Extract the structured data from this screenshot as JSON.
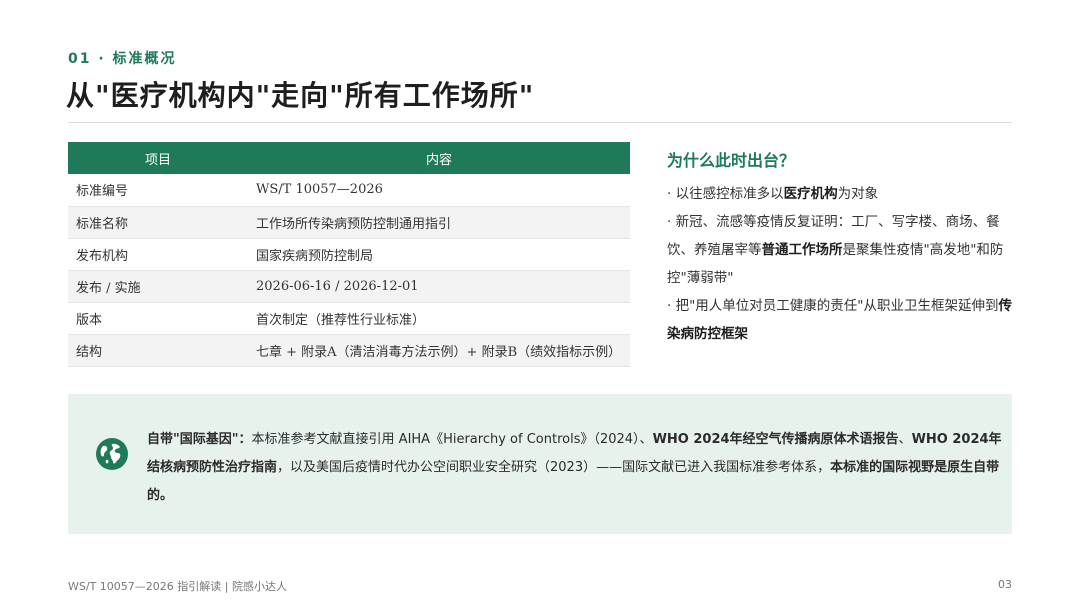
{
  "section_label": "01 · 标准概况",
  "title": "从\"医疗机构内\"走向\"所有工作场所\"",
  "table": {
    "headers": [
      "项目",
      "内容"
    ],
    "rows": [
      [
        "标准编号",
        "WS/T 10057—2026"
      ],
      [
        "标准名称",
        "工作场所传染病预防控制通用指引"
      ],
      [
        "发布机构",
        "国家疾病预防控制局"
      ],
      [
        "发布 / 实施",
        "2026-06-16 / 2026-12-01"
      ],
      [
        "版本",
        "首次制定（推荐性行业标准）"
      ],
      [
        "结构",
        "七章 + 附录A（清洁消毒方法示例）+ 附录B（绩效指标示例）"
      ]
    ]
  },
  "why": {
    "title": "为什么此时出台？",
    "p1_a": "· 以往感控标准多以",
    "p1_b": "医疗机构",
    "p1_c": "为对象",
    "p2_a": "· 新冠、流感等疫情反复证明：工厂、写字楼、商场、餐饮、养殖屠宰等",
    "p2_b": "普通工作场所",
    "p2_c": "是聚集性疫情\"高发地\"和防控\"薄弱带\"",
    "p3_a": "· 把\"用人单位对员工健康的责任\"从职业卫生框架延伸到",
    "p3_b": "传染病防控框架"
  },
  "callout": {
    "lead": "自带\"国际基因\"：",
    "t1": "本标准参考文献直接引用 AIHA《Hierarchy of Controls》（2024）、",
    "b1": "WHO 2024年经空气传播病原体术语报告",
    "t2": "、",
    "b2": "WHO 2024年结核病预防性治疗指南",
    "t3": "，以及美国后疫情时代办公空间职业安全研究（2023）——国际文献已进入我国标准参考体系，",
    "b3": "本标准的国际视野是原生自带的。"
  },
  "footer": {
    "left": "WS/T 10057—2026 指引解读 | 院感小达人",
    "page": "03"
  },
  "colors": {
    "accent": "#1f7a5a",
    "callout_bg": "#e8f2ed"
  },
  "icons": {
    "callout": "globe-icon"
  }
}
